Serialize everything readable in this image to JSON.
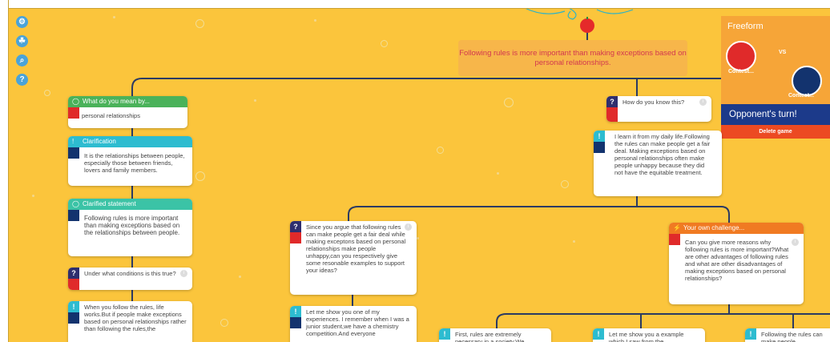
{
  "toolbar": {
    "icons": [
      "settings-icon",
      "plant-icon",
      "zoom-icon",
      "help-icon"
    ],
    "glyphs": [
      "⚙",
      "☘",
      "⌕",
      "?"
    ]
  },
  "main_claim": "Following rules is more important than making exceptions based on personal relationships.",
  "panel": {
    "mode": "Freeform",
    "vs": "VS",
    "contestant1": "Contest...",
    "contestant2": "Contest...",
    "turn": "Opponent's turn!",
    "delete": "Delete game",
    "colors": {
      "contestant1": "#e02a2a",
      "contestant2": "#13336e"
    }
  },
  "cards": {
    "what_mean": {
      "header": "What do you mean by...",
      "body": "personal relationships"
    },
    "clarification": {
      "header": "Clarification",
      "body": "It is the relationships between people, especially those between friends, lovers and family members."
    },
    "clarified": {
      "header": "Clarified statement",
      "body": "Following rules is more important than making exceptions based on the relationships between people."
    },
    "under_what": {
      "badge": "?",
      "body": "Under what conditions is this true?"
    },
    "when_follow": {
      "badge": "!",
      "body": "When you follow the rules, life works.But if people make exceptions based on personal relationships rather than following the rules,the"
    },
    "since_argue": {
      "badge": "?",
      "body": "Since you argue that following rules can make people get a fair deal while making exceptons based on personal relationships make people unhappy,can you respectively give some resonable examples to support your ideas?"
    },
    "let_me_show": {
      "badge": "!",
      "body": "Let me show you one of my experiences. I remember when I was a junior student,we have a chemistry competition.And everyone"
    },
    "how_know": {
      "badge": "?",
      "body": "How do you know this?"
    },
    "learn_daily": {
      "badge": "!",
      "body": "I learn it from my daily life.Following the rules can make people get a fair deal. Making exceptions based on personal relationships often make people unhappy because they did not have the equitable treatment."
    },
    "own_challenge": {
      "header": "Your own challenge...",
      "body": "Can you give more reasons why following rules is more important?What are other advantages of following rules and what are other disadvantages of making exceptions based on personal relationships?"
    },
    "first_rules": {
      "badge": "!",
      "body": "First, rules are extremely necessary in a society.We"
    },
    "example": {
      "badge": "!",
      "body": "Let me show you a example which I saw from the"
    },
    "following_rules": {
      "badge": "!",
      "body": "Following the rules can make people"
    }
  }
}
